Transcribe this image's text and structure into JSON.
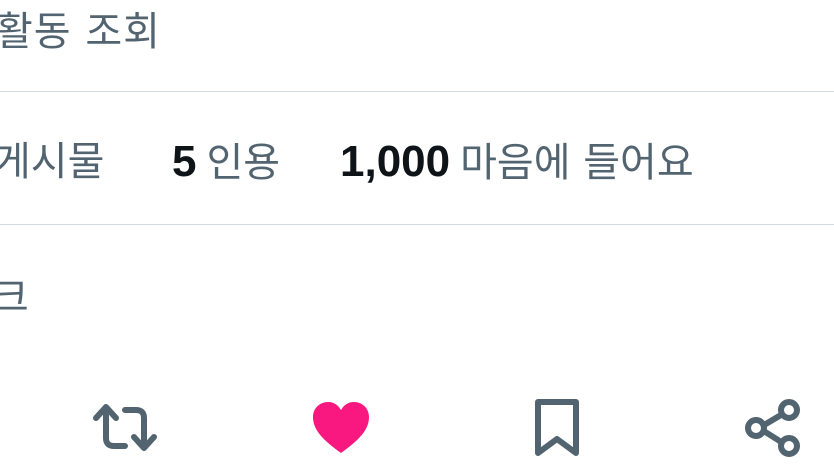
{
  "activity": {
    "label": "활동 조회"
  },
  "stats": {
    "posts_label": "게시물",
    "quotes_count": "5",
    "quotes_label": "인용",
    "likes_count": "1,000",
    "likes_label": "마음에 들어요"
  },
  "partial_row": {
    "label": "크"
  },
  "actions": {
    "retweet_icon": "retweet-icon",
    "like_icon": "heart-icon",
    "bookmark_icon": "bookmark-icon",
    "share_icon": "share-icon",
    "like_color": "#f91880",
    "icon_color": "#536471"
  }
}
